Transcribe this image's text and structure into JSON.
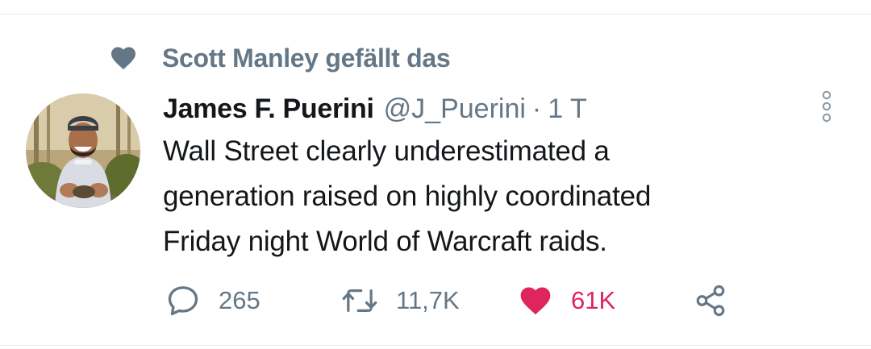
{
  "social_context": {
    "text": "Scott Manley gefällt das"
  },
  "tweet": {
    "author_name": "James F. Puerini",
    "handle": "@J_Puerini",
    "separator": "·",
    "time": "1 T",
    "text_lines": [
      "Wall Street clearly underestimated a",
      "generation raised on highly coordinated",
      "Friday night World of Warcraft raids."
    ]
  },
  "actions": {
    "reply_count": "265",
    "retweet_count": "11,7K",
    "like_count": "61K"
  },
  "colors": {
    "secondary_text": "#657786",
    "primary_text": "#14171a",
    "like_red": "#e0245e",
    "divider": "#e6ecf0"
  },
  "icons": {
    "social_context": "heart-icon",
    "reply": "comment-bubble-icon",
    "retweet": "retweet-icon",
    "like": "heart-filled-icon",
    "share": "share-icon",
    "more": "more-vertical-icon"
  }
}
